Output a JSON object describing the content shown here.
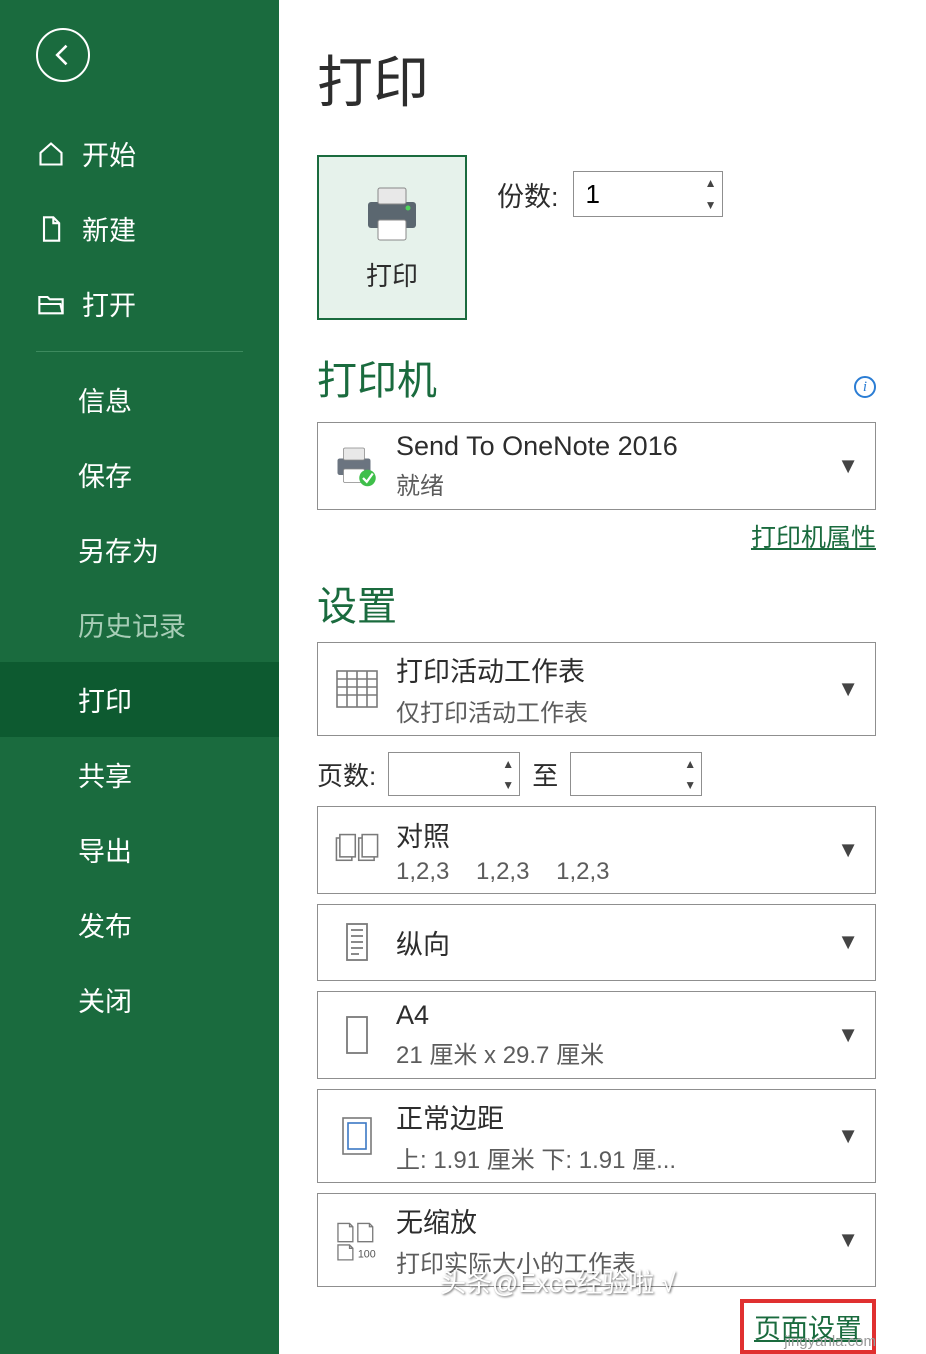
{
  "sidebar": {
    "items": [
      {
        "label": "开始"
      },
      {
        "label": "新建"
      },
      {
        "label": "打开"
      },
      {
        "label": "信息"
      },
      {
        "label": "保存"
      },
      {
        "label": "另存为"
      },
      {
        "label": "历史记录"
      },
      {
        "label": "打印"
      },
      {
        "label": "共享"
      },
      {
        "label": "导出"
      },
      {
        "label": "发布"
      },
      {
        "label": "关闭"
      }
    ]
  },
  "page": {
    "title": "打印",
    "print_button": "打印",
    "copies_label": "份数:",
    "copies_value": "1",
    "printer_section": "打印机",
    "printer": {
      "name": "Send To OneNote 2016",
      "status": "就绪"
    },
    "printer_properties": "打印机属性",
    "settings_section": "设置",
    "settings": {
      "scope": {
        "title": "打印活动工作表",
        "sub": "仅打印活动工作表"
      },
      "pages_label": "页数:",
      "pages_to_label": "至",
      "collate": {
        "title": "对照",
        "sub": "1,2,3    1,2,3    1,2,3"
      },
      "orientation": {
        "title": "纵向"
      },
      "paper": {
        "title": "A4",
        "sub": "21 厘米 x 29.7 厘米"
      },
      "margins": {
        "title": "正常边距",
        "sub": "上: 1.91 厘米 下: 1.91 厘..."
      },
      "scaling": {
        "title": "无缩放",
        "sub": "打印实际大小的工作表",
        "badge": "100"
      }
    },
    "page_setup": "页面设置"
  },
  "watermark": "jingyanla.com",
  "watermark2": "头条@Exce经验啦 √"
}
